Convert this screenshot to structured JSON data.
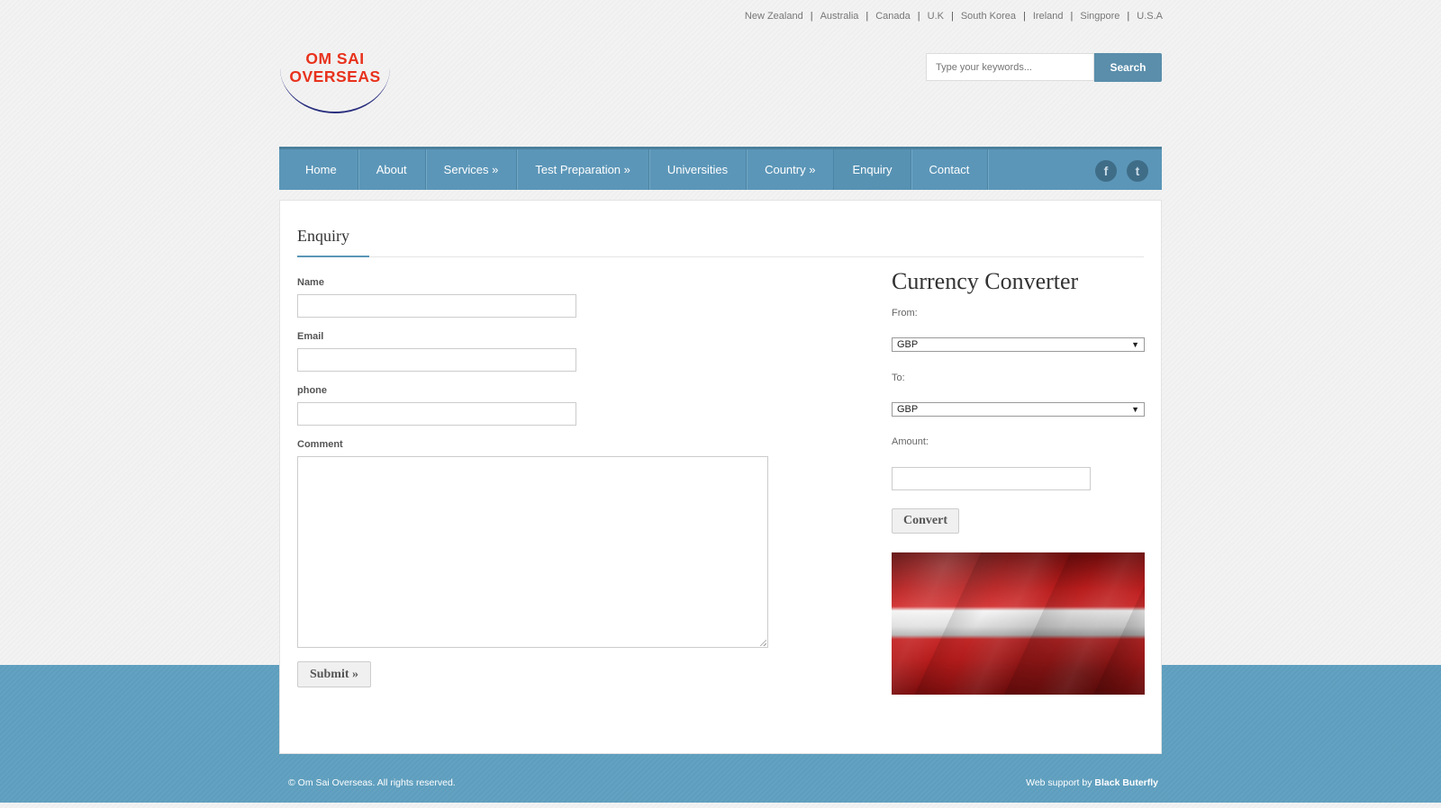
{
  "top_links": [
    "New Zealand",
    "Australia",
    "Canada",
    "U.K",
    "South Korea",
    "Ireland",
    "Singpore",
    "U.S.A"
  ],
  "logo": {
    "line1": "OM SAI",
    "line2": "OVERSEAS"
  },
  "search": {
    "placeholder": "Type your keywords...",
    "button": "Search"
  },
  "nav": [
    "Home",
    "About",
    "Services  »",
    "Test Preparation  »",
    "Universities",
    "Country  »",
    "Enquiry",
    "Contact"
  ],
  "social": {
    "facebook": "f",
    "twitter": "t"
  },
  "form": {
    "title": "Enquiry",
    "name_label": "Name",
    "email_label": "Email",
    "phone_label": "phone",
    "comment_label": "Comment",
    "submit": "Submit »"
  },
  "converter": {
    "title": "Currency Converter",
    "from_label": "From:",
    "from_value": "GBP",
    "to_label": "To:",
    "to_value": "GBP",
    "amount_label": "Amount:",
    "convert": "Convert"
  },
  "footer": {
    "copyright": "© Om Sai Overseas. All rights reserved.",
    "support_prefix": "Web support by",
    "support_name": "Black Buterfly"
  }
}
